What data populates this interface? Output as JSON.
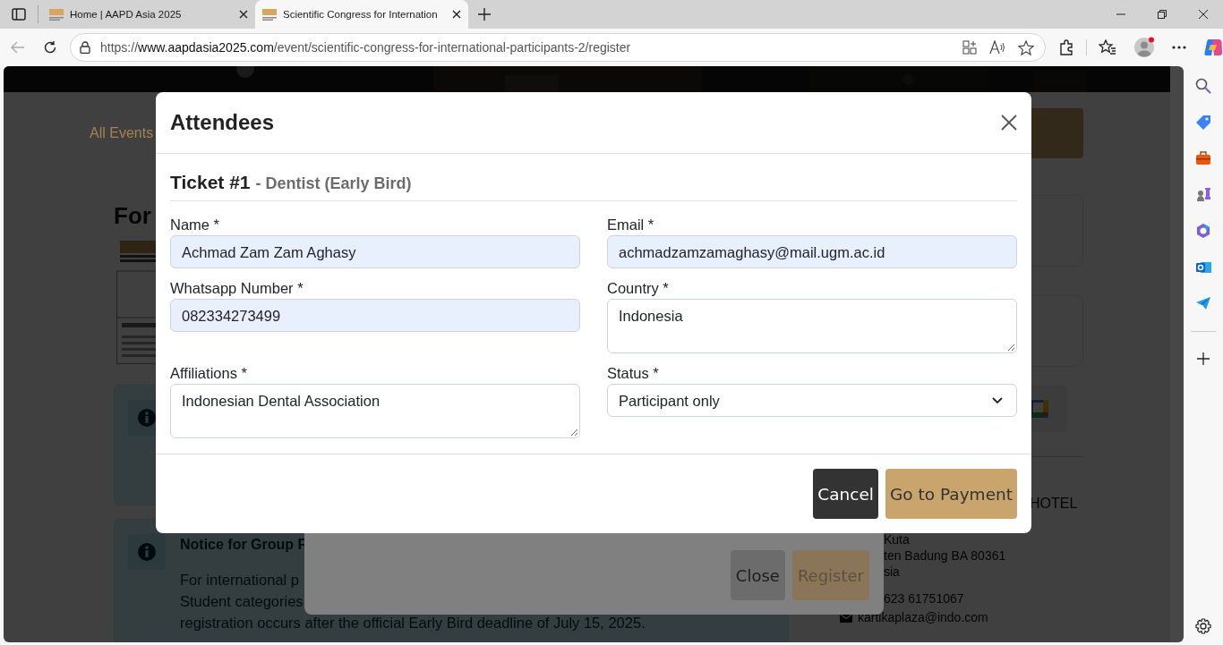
{
  "browser": {
    "tabs": [
      {
        "title": "Home | AAPD Asia 2025",
        "selected": false
      },
      {
        "title": "Scientific Congress for Internation",
        "selected": true
      }
    ],
    "address": {
      "scheme": "https://",
      "host": "www.aapdasia2025.com",
      "path": "/event/scientific-congress-for-international-participants-2/register"
    }
  },
  "page": {
    "nav_link": "All Events",
    "heading": "For",
    "notices": [
      {
        "kind": "info"
      },
      {
        "kind": "info",
        "title": "Notice for Group F",
        "lines": [
          "For international p",
          "Student categories",
          "registration occurs after the official Early Bird deadline of July 15, 2025."
        ]
      }
    ],
    "venue": {
      "name": "HOTEL",
      "address_lines": [
        "Kuta",
        "ten Badung BA 80361",
        "sia"
      ],
      "phone": "623 61751067",
      "email": "kartikaplaza@indo.com"
    }
  },
  "register_modal": {
    "buttons": [
      {
        "label": "Close",
        "kind": "secondary",
        "disabled": false
      },
      {
        "label": "Register",
        "kind": "primary",
        "disabled": true
      }
    ]
  },
  "attendees_modal": {
    "title": "Attendees",
    "ticket": {
      "number": "Ticket #1",
      "type": "- Dentist (Early Bird)"
    },
    "fields": [
      {
        "label": "Name *",
        "kind": "input",
        "value": "Achmad Zam Zam Aghasy",
        "autofilled": true
      },
      {
        "label": "Email *",
        "kind": "input",
        "value": "achmadzamzamaghasy@mail.ugm.ac.id",
        "autofilled": true
      },
      {
        "label": "Whatsapp Number *",
        "kind": "input",
        "value": "082334273499",
        "autofilled": true
      },
      {
        "label": "Country *",
        "kind": "textarea",
        "value": "Indonesia",
        "autofilled": false
      },
      {
        "label": "Affiliations *",
        "kind": "textarea",
        "value": "Indonesian Dental Association",
        "autofilled": false
      },
      {
        "label": "Status *",
        "kind": "select",
        "value": "Participant only",
        "autofilled": false
      }
    ],
    "buttons": [
      {
        "label": "Cancel",
        "kind": "secondary"
      },
      {
        "label": "Go to Payment",
        "kind": "primary"
      }
    ]
  }
}
